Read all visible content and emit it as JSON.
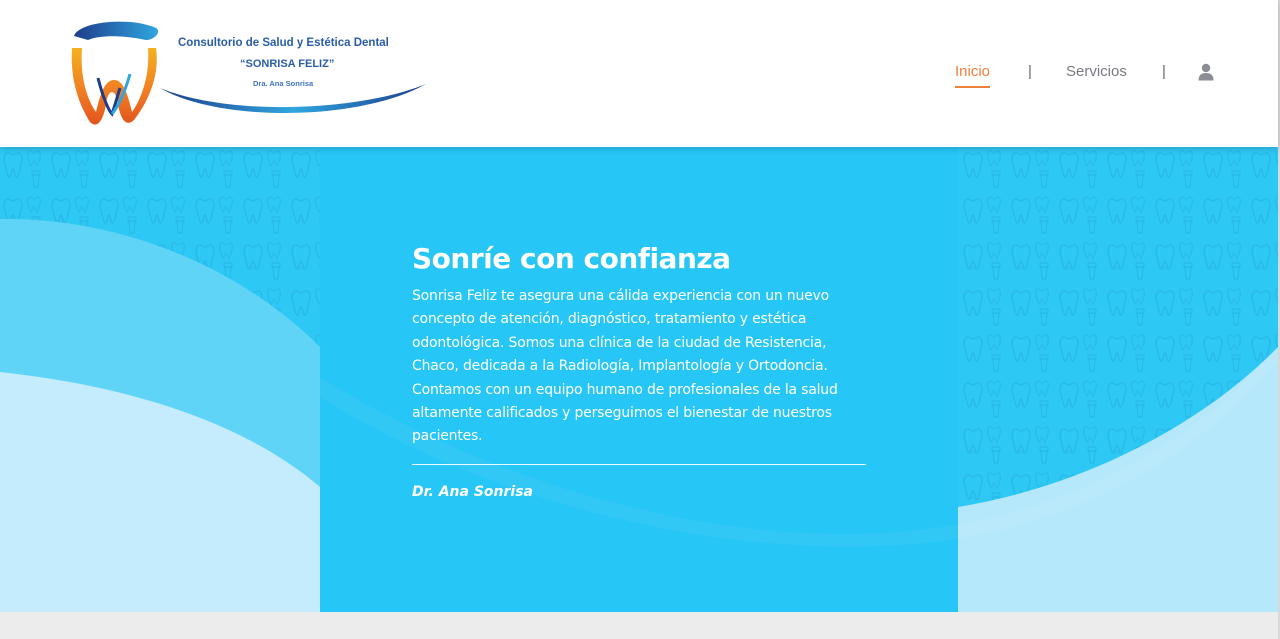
{
  "header": {
    "logo": {
      "line1": "Consultorio de Salud y Estética Dental",
      "line2": "“SONRISA FELIZ”",
      "line3": "Dra. Ana Sonrisa"
    },
    "nav": {
      "items": [
        {
          "label": "Inicio",
          "active": true
        },
        {
          "label": "Servicios",
          "active": false
        }
      ],
      "separator": "|",
      "user_icon": "user-icon"
    }
  },
  "hero": {
    "title": "Sonríe con confianza",
    "text": "Sonrisa Feliz te asegura una cálida experiencia con un nuevo concepto de atención, diagnóstico, tratamiento y estética odontológica. Somos una clínica de la ciudad de Resistencia, Chaco, dedicada a la Radiología, Implantología y Ortodoncia. Contamos con un equipo humano de profesionales de la salud altamente calificados y perseguimos el bienestar de nuestros pacientes.",
    "author": "Dr. Ana Sonrisa"
  },
  "colors": {
    "accent": "#ef7f3c",
    "hero_blue": "#2ec8f5",
    "hero_light": "#bfeafc",
    "nav_text": "#777a80",
    "logo_blue": "#2b5da6"
  }
}
